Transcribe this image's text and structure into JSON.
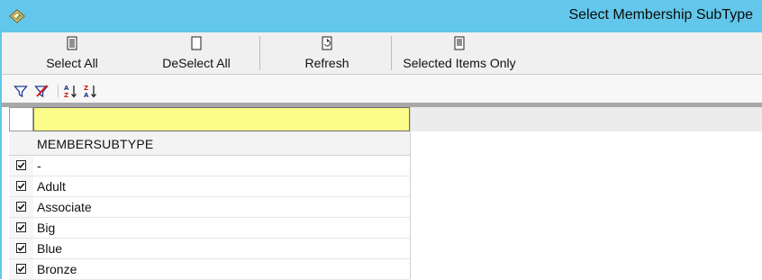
{
  "window": {
    "title": "Select Membership SubType"
  },
  "toolbar": {
    "select_all": "Select All",
    "deselect_all": "DeSelect All",
    "refresh": "Refresh",
    "selected_items_only": "Selected Items Only"
  },
  "grid": {
    "filter_value": "",
    "column_header": "MEMBERSUBTYPE",
    "rows": [
      {
        "label": "-",
        "checked": true
      },
      {
        "label": "Adult",
        "checked": true
      },
      {
        "label": "Associate",
        "checked": true
      },
      {
        "label": "Big",
        "checked": true
      },
      {
        "label": "Blue",
        "checked": true
      },
      {
        "label": "Bronze",
        "checked": true
      }
    ]
  },
  "colors": {
    "titlebar": "#62c7ea",
    "filter_cell": "#fcfc8a"
  }
}
